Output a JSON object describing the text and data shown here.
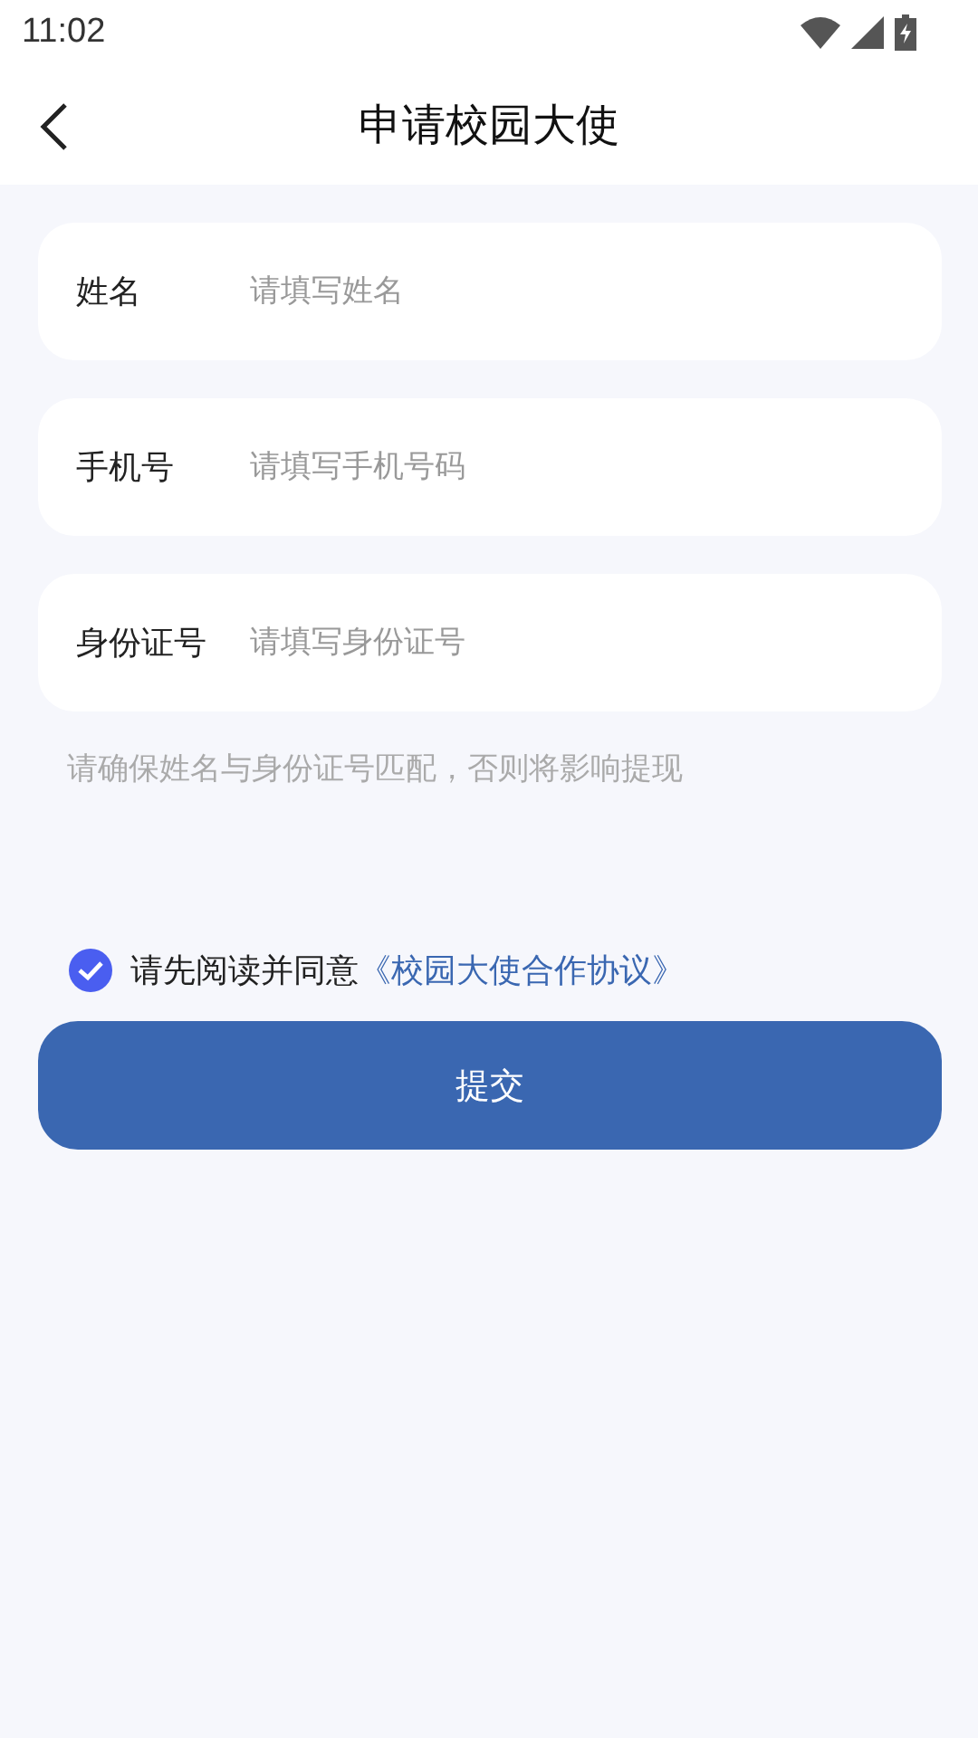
{
  "status_bar": {
    "time": "11:02"
  },
  "header": {
    "title": "申请校园大使"
  },
  "fields": [
    {
      "label": "姓名",
      "placeholder": "请填写姓名"
    },
    {
      "label": "手机号",
      "placeholder": "请填写手机号码"
    },
    {
      "label": "身份证号",
      "placeholder": "请填写身份证号"
    }
  ],
  "notice": "请确保姓名与身份证号匹配，否则将影响提现",
  "agreement": {
    "checked": true,
    "text": "请先阅读并同意",
    "link": "《校园大使合作协议》"
  },
  "submit_button": "提交"
}
